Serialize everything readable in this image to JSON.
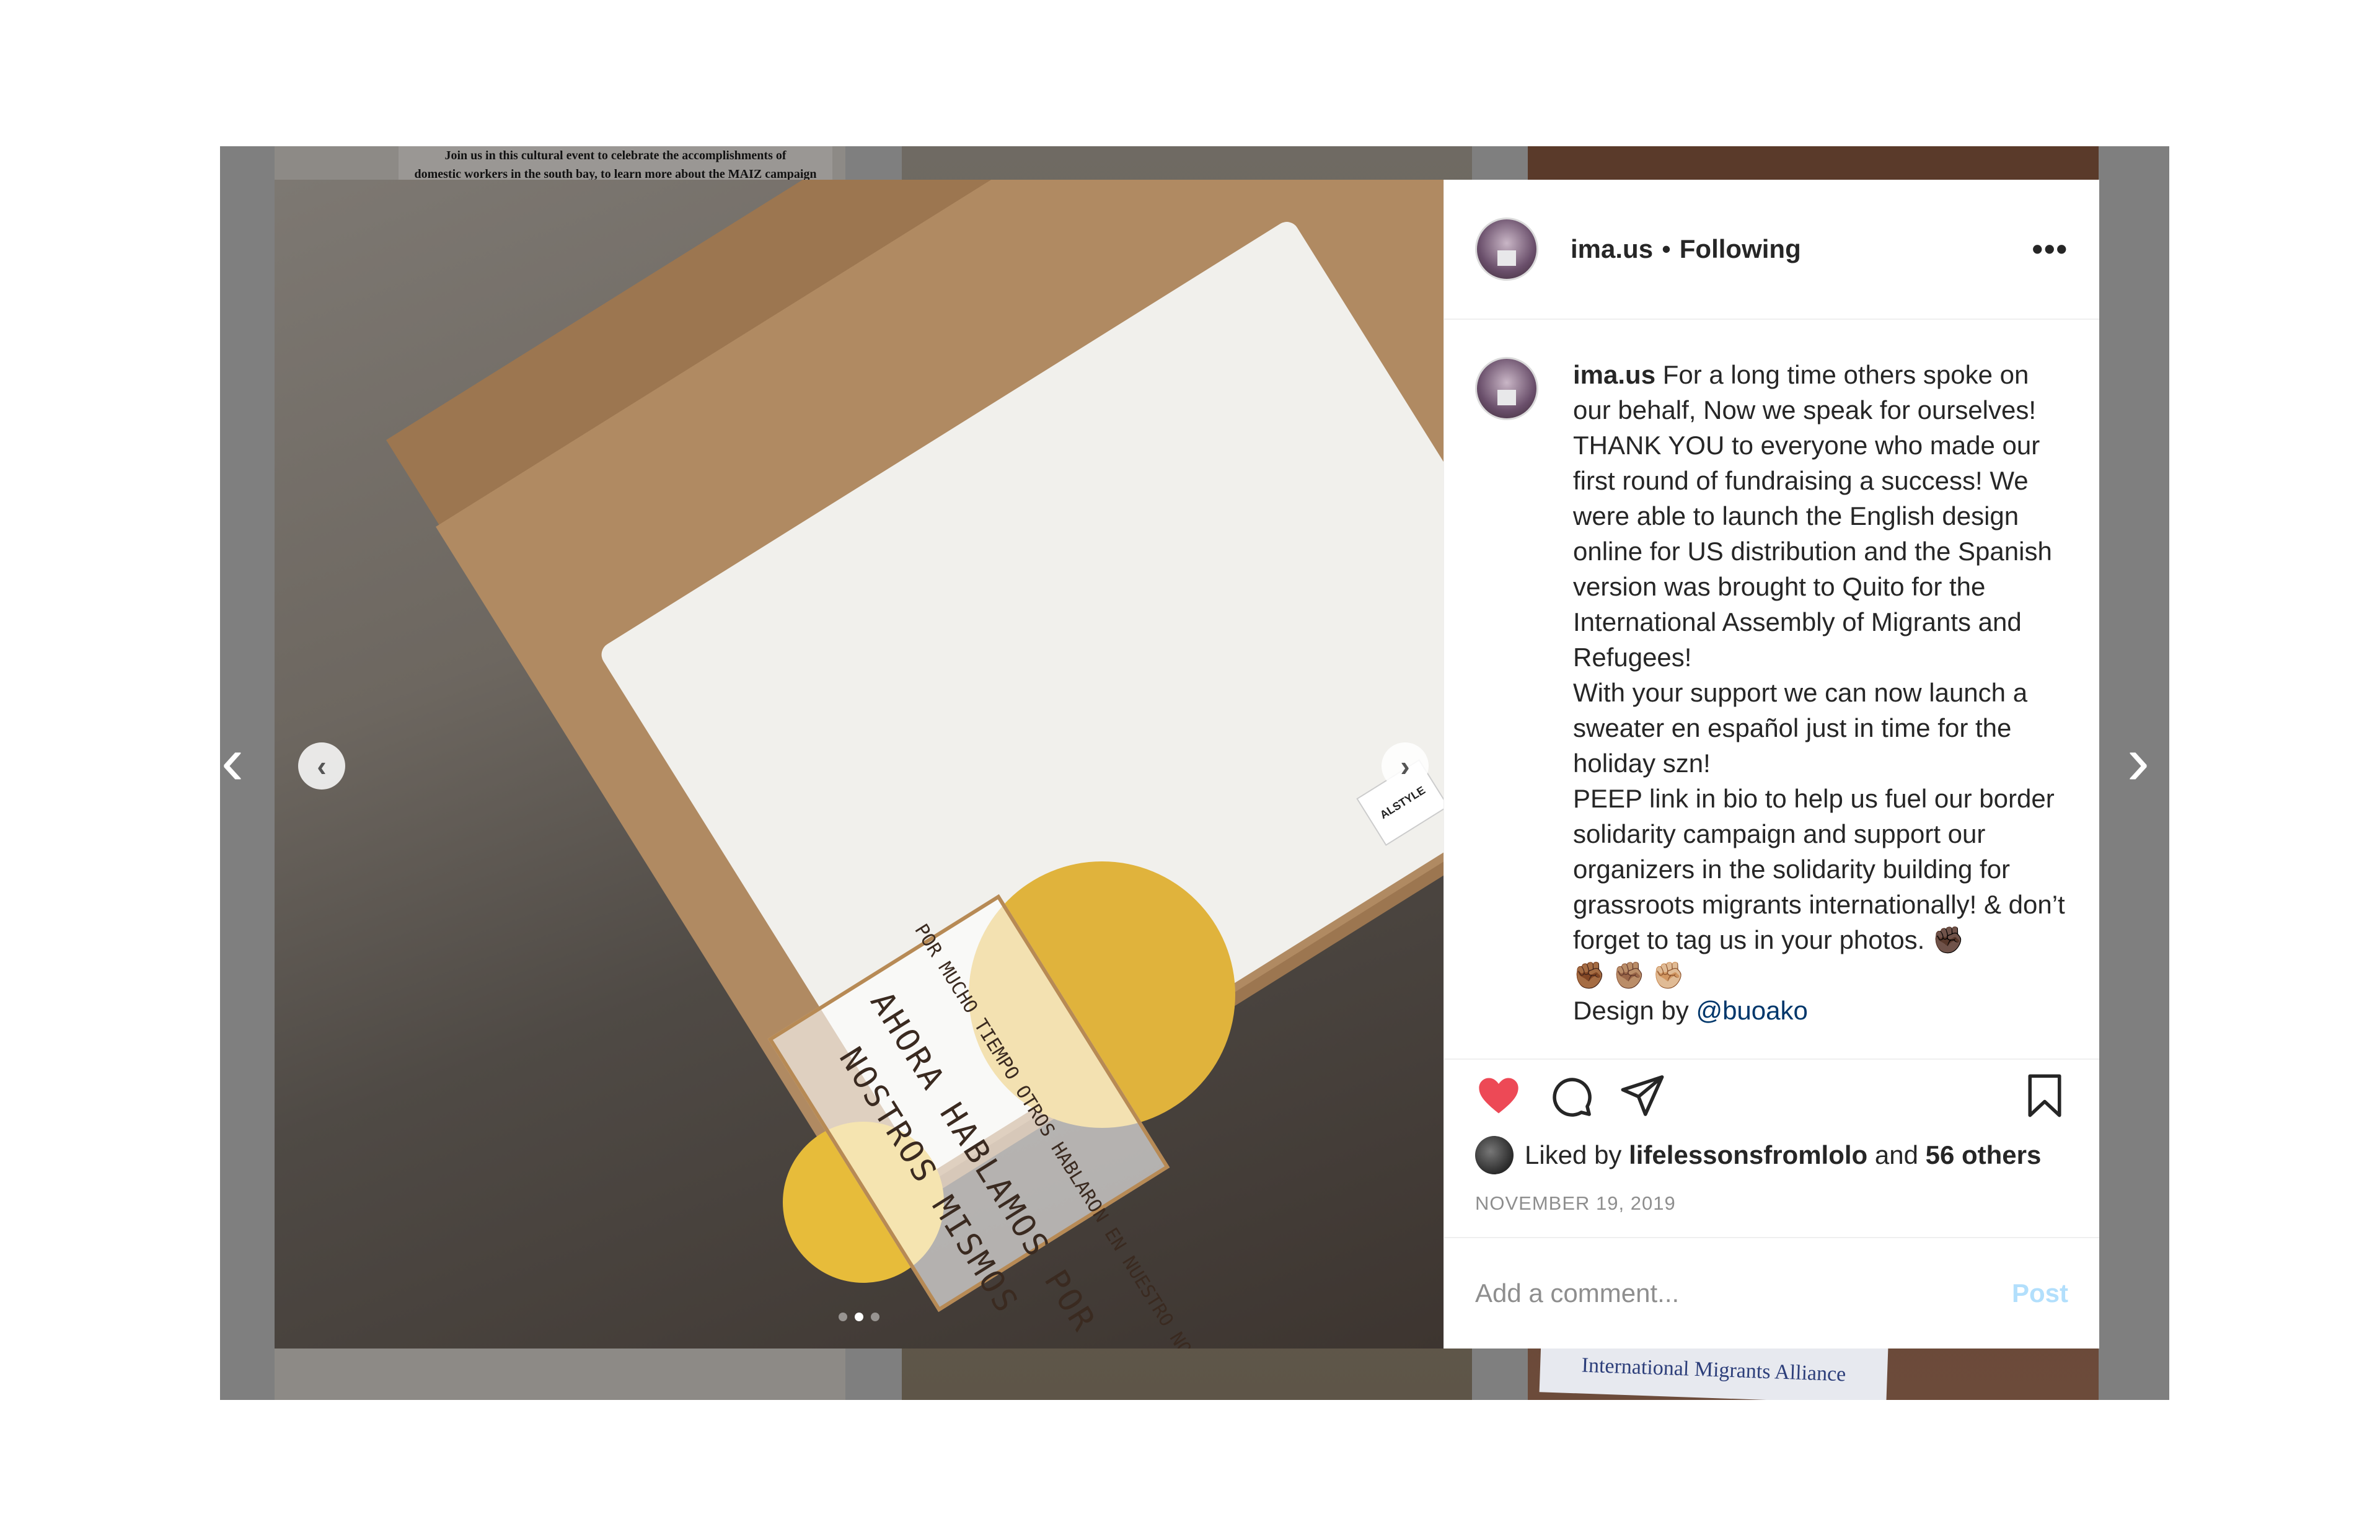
{
  "background": {
    "flyer_line1": "Join us in this cultural event to celebrate the accomplishments of",
    "flyer_line2": "domestic workers in the south bay, to learn more about the MAIZ campaign",
    "banner_text": "International Migrants Alliance"
  },
  "navigation": {
    "prev_symbol": "‹",
    "next_symbol": "›"
  },
  "photo": {
    "shirt_line1": "POR MUCHO TIEMPO OTROS HABLARON EN NUESTRO NOMBRE",
    "shirt_line2": "AHORA HABLAMOS POR",
    "shirt_line3": "NOSTROS MISMOS",
    "label_text": "ALSTYLE",
    "carousel_prev": "‹",
    "carousel_next": "›",
    "dots": 3,
    "active_dot": 2
  },
  "header": {
    "username": "ima.us",
    "separator": "•",
    "follow_status": "Following",
    "more_label": "•••"
  },
  "caption": {
    "username": "ima.us",
    "text": "For a long time others spoke on our behalf, Now we speak for ourselves! THANK YOU to everyone who made our first round of fundraising a success! We were able to launch the English design online for US distribution and the Spanish version was brought to Quito for the International Assembly of Migrants and Refugees!",
    "text2": "With your support we can now launch a sweater en español just in time for the holiday szn!",
    "text3": "PEEP link in bio to help us fuel our border solidarity campaign and support our organizers in the solidarity building for grassroots migrants internationally! & don’t forget to tag us in your photos. ✊🏿",
    "text4": "✊🏾 ✊🏽 ✊🏼",
    "design_prefix": "Design by",
    "design_mention": "@buoako"
  },
  "actions": {
    "like_icon": "heart-filled",
    "comment_icon": "speech-bubble",
    "share_icon": "paper-plane",
    "save_icon": "bookmark"
  },
  "likes": {
    "prefix": "Liked by",
    "user": "lifelessonsfromlolo",
    "conjunction": "and",
    "others": "56 others"
  },
  "date": "NOVEMBER 19, 2019",
  "comment": {
    "placeholder": "Add a comment...",
    "post_label": "Post"
  },
  "colors": {
    "like": "#ed4956",
    "mention": "#00376b",
    "post_disabled": "#b2dffc",
    "overlay": "#7f7f7f"
  }
}
